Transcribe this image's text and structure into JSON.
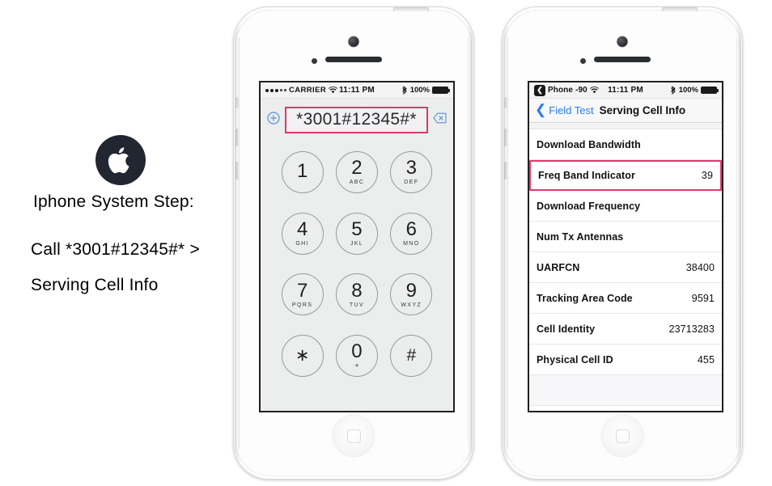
{
  "instructions": {
    "logo_icon": "apple-logo-icon",
    "title": "Iphone System Step:",
    "line1": "Call *3001#12345#* >",
    "line2": "Serving Cell Info"
  },
  "colors": {
    "highlight_pink": "#e0386b",
    "ios_blue": "#2b7bf3",
    "screen_gray": "#eceded"
  },
  "phone_left": {
    "status_bar": {
      "signal_dots_filled": 3,
      "signal_dots_empty": 2,
      "carrier": "CARRIER",
      "wifi_icon": "wifi-icon",
      "time": "11:11 PM",
      "bluetooth_icon": "bluetooth-icon",
      "battery_percent": "100%",
      "battery_icon": "battery-full-icon"
    },
    "dialer": {
      "add_contact_icon": "circle-plus-icon",
      "number": "*3001#12345#*",
      "backspace_icon": "backspace-icon",
      "keys": [
        {
          "digit": "1",
          "letters": ""
        },
        {
          "digit": "2",
          "letters": "ABC"
        },
        {
          "digit": "3",
          "letters": "DEF"
        },
        {
          "digit": "4",
          "letters": "GHI"
        },
        {
          "digit": "5",
          "letters": "JKL"
        },
        {
          "digit": "6",
          "letters": "MNO"
        },
        {
          "digit": "7",
          "letters": "PQRS"
        },
        {
          "digit": "8",
          "letters": "TUV"
        },
        {
          "digit": "9",
          "letters": "WXYZ"
        },
        {
          "digit": "∗",
          "letters": ""
        },
        {
          "digit": "0",
          "letters": "+"
        },
        {
          "digit": "#",
          "letters": ""
        }
      ]
    }
  },
  "phone_right": {
    "status_bar": {
      "back_chip_icon": "back-chevron-chip-icon",
      "app_label": "Phone",
      "signal_value": "-90",
      "wifi_icon": "wifi-icon",
      "time": "11:11 PM",
      "bluetooth_icon": "bluetooth-icon",
      "battery_percent": "100%",
      "battery_icon": "battery-full-icon"
    },
    "navbar": {
      "back_icon": "chevron-left-icon",
      "back_label": "Field Test",
      "title": "Serving Cell Info"
    },
    "rows": [
      {
        "label": "Download Bandwidth",
        "value": "",
        "highlighted": false
      },
      {
        "label": "Freq Band Indicator",
        "value": "39",
        "highlighted": true
      },
      {
        "label": "Download Frequency",
        "value": "",
        "highlighted": false
      },
      {
        "label": "Num Tx Antennas",
        "value": "",
        "highlighted": false
      },
      {
        "label": "UARFCN",
        "value": "38400",
        "highlighted": false
      },
      {
        "label": "Tracking Area Code",
        "value": "9591",
        "highlighted": false
      },
      {
        "label": "Cell Identity",
        "value": "23713283",
        "highlighted": false
      },
      {
        "label": "Physical Cell ID",
        "value": "455",
        "highlighted": false
      }
    ]
  }
}
